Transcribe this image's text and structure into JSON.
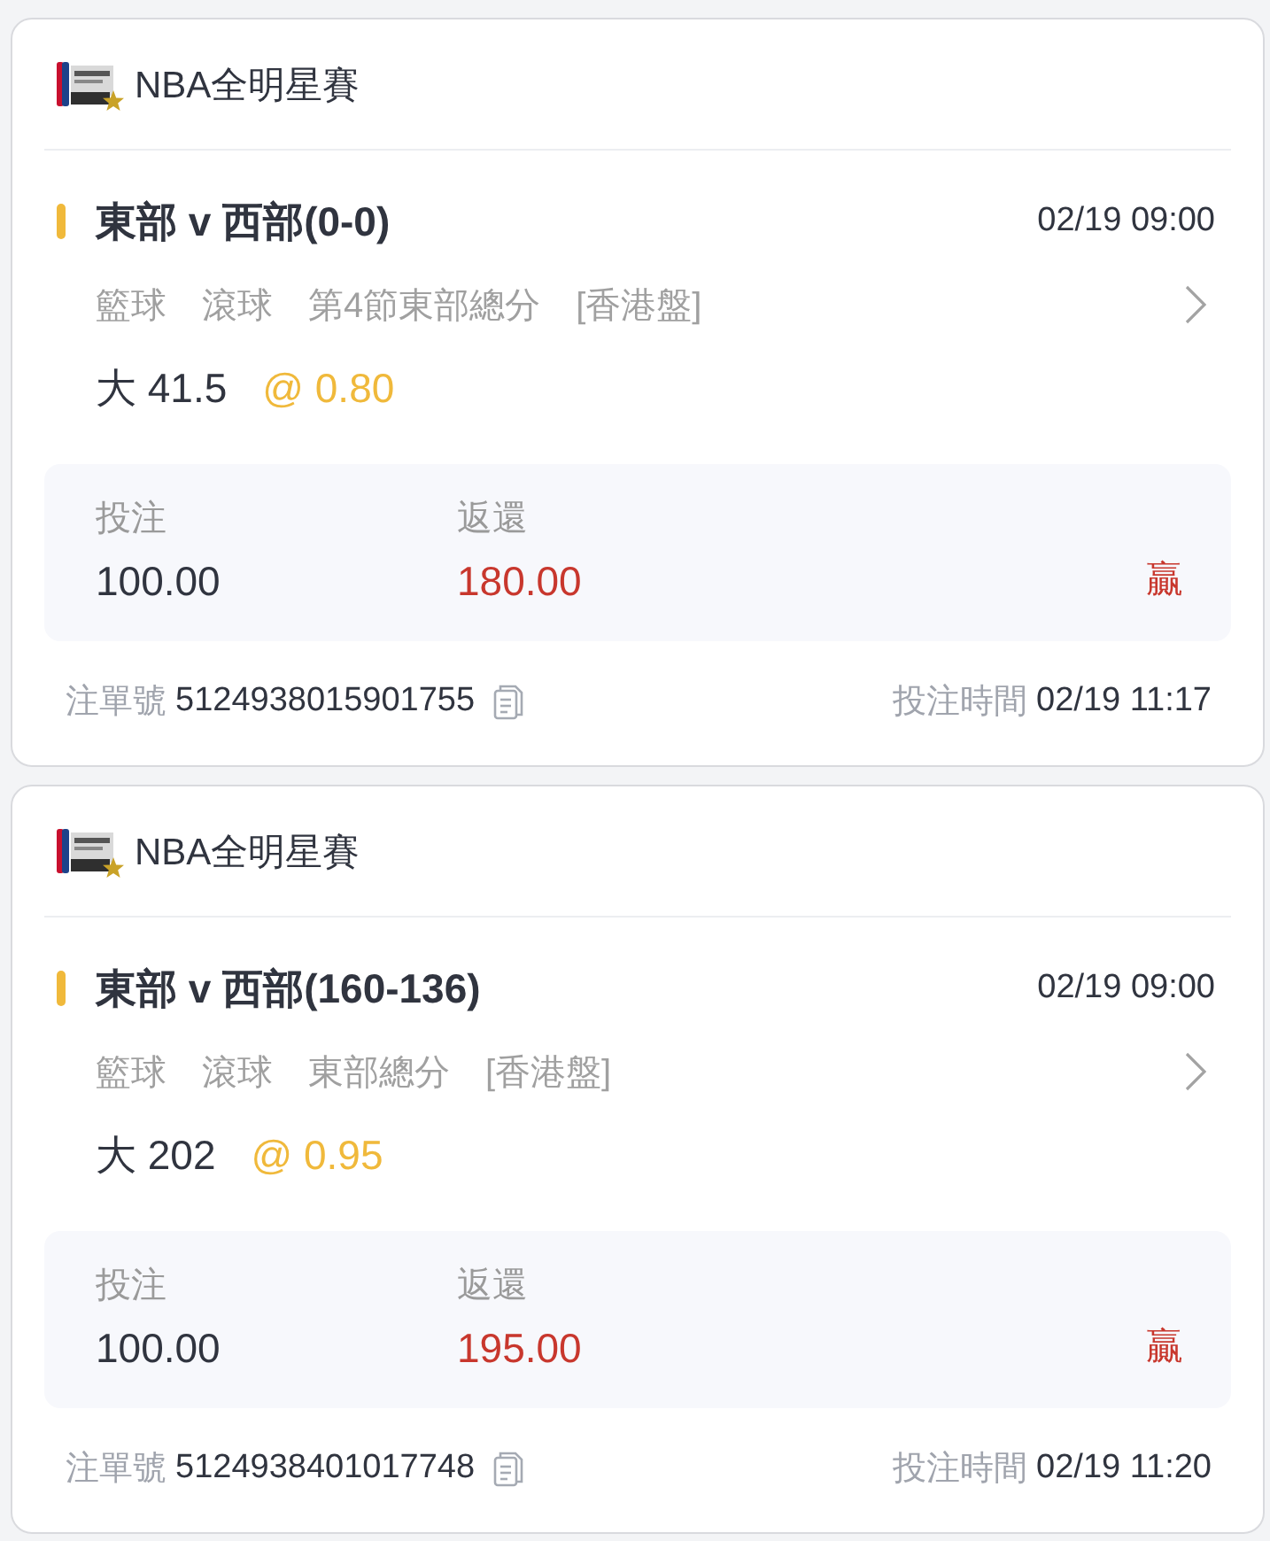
{
  "bets": [
    {
      "league": "NBA全明星賽",
      "match": "東部 v 西部(0-0)",
      "time": "02/19 09:00",
      "tags": [
        "籃球",
        "滾球",
        "第4節東部總分",
        "[香港盤]"
      ],
      "selection": "大 41.5",
      "odds": "@ 0.80",
      "stake_label": "投注",
      "stake": "100.00",
      "return_label": "返還",
      "return": "180.00",
      "won": true,
      "result": "贏",
      "ticket_label": "注單號",
      "ticket_no": "5124938015901755",
      "placed_label": "投注時間",
      "placed_at": "02/19 11:17"
    },
    {
      "league": "NBA全明星賽",
      "match": "東部 v 西部(160-136)",
      "time": "02/19 09:00",
      "tags": [
        "籃球",
        "滾球",
        "東部總分",
        "[香港盤]"
      ],
      "selection": "大 202",
      "odds": "@ 0.95",
      "stake_label": "投注",
      "stake": "100.00",
      "return_label": "返還",
      "return": "195.00",
      "won": true,
      "result": "贏",
      "ticket_label": "注單號",
      "ticket_no": "5124938401017748",
      "placed_label": "投注時間",
      "placed_at": "02/19 11:20"
    }
  ]
}
